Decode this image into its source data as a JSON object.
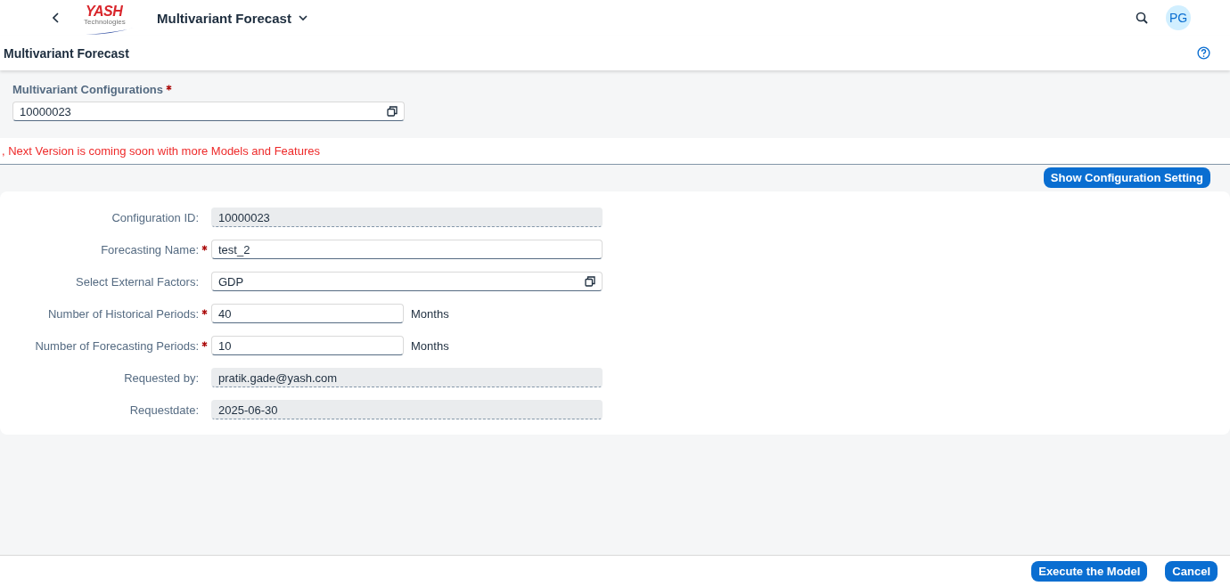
{
  "shell": {
    "logo": {
      "text": "YASH",
      "subtext": "Technologies"
    },
    "title": "Multivariant Forecast",
    "avatar": "PG"
  },
  "page": {
    "title": "Multivariant Forecast"
  },
  "config_selector": {
    "label": "Multivariant Configurations",
    "required": true,
    "value": "10000023"
  },
  "message": ", Next Version is coming soon with more Models and Features",
  "show_settings_button": "Show Configuration Setting",
  "form": [
    {
      "label": "Configuration ID:",
      "kind": "readonly",
      "required": false,
      "value": "10000023"
    },
    {
      "label": "Forecasting Name:",
      "kind": "input",
      "required": true,
      "value": "test_2"
    },
    {
      "label": "Select External Factors:",
      "kind": "valuehelp",
      "required": false,
      "value": "GDP"
    },
    {
      "label": "Number of Historical Periods:",
      "kind": "short",
      "required": true,
      "value": "40",
      "unit": "Months"
    },
    {
      "label": "Number of Forecasting Periods:",
      "kind": "short",
      "required": true,
      "value": "10",
      "unit": "Months"
    },
    {
      "label": "Requested by:",
      "kind": "readonly",
      "required": false,
      "value": "pratik.gade@yash.com"
    },
    {
      "label": "Requestdate:",
      "kind": "readonly",
      "required": false,
      "value": "2025-06-30"
    }
  ],
  "footer_buttons": [
    "Execute the Model",
    "Cancel"
  ]
}
